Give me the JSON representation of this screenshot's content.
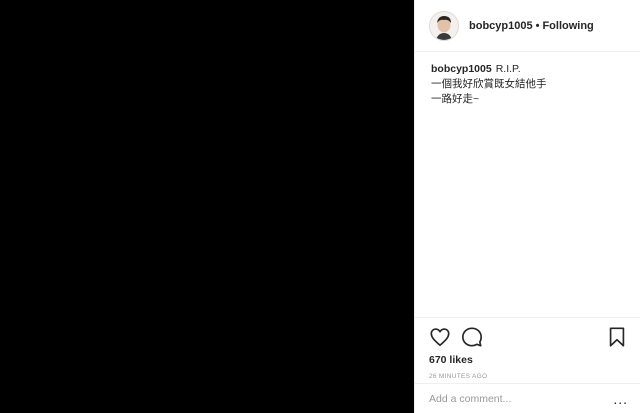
{
  "post": {
    "username": "bobcyp1005",
    "separator": "•",
    "follow_status": "Following",
    "caption_user": "bobcyp1005",
    "caption_lines": [
      "R.I.P.",
      "一個我好欣賞既女結他手",
      "一路好走~"
    ],
    "likes": "670 likes",
    "time": "26 MINUTES AGO",
    "comment_placeholder": "Add a comment...",
    "more_label": "..."
  },
  "icons": {
    "avatar": "profile-avatar",
    "like": "heart-icon",
    "comment": "comment-icon",
    "save": "bookmark-icon"
  },
  "colors": {
    "media_bg": "#000000",
    "text": "#262626",
    "muted": "#999999",
    "border": "#efefef"
  }
}
